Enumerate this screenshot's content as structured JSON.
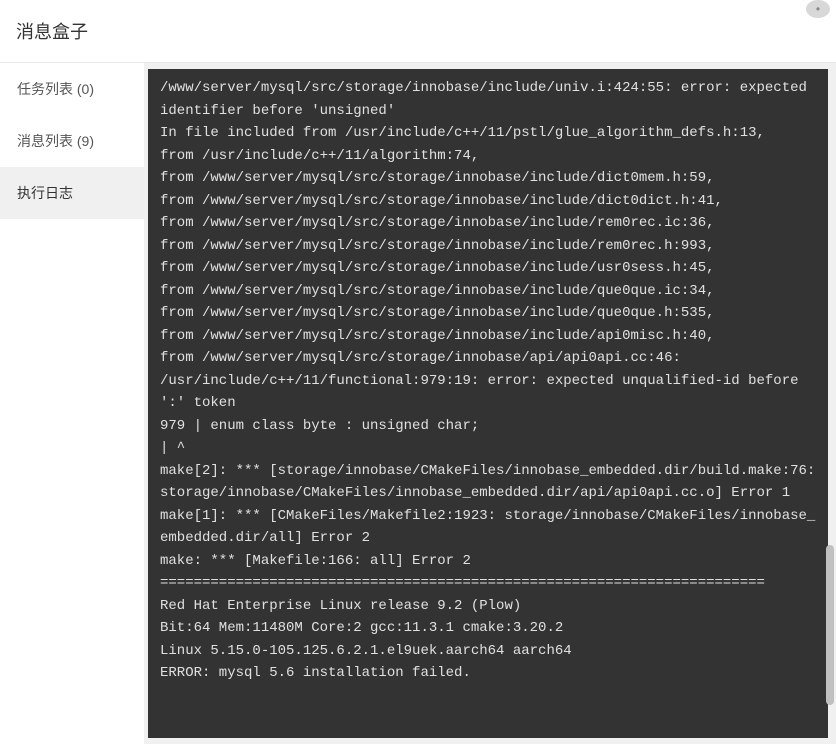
{
  "header": {
    "title": "消息盒子"
  },
  "sidebar": {
    "items": [
      {
        "label": "任务列表 (0)",
        "key": "task-list",
        "active": false
      },
      {
        "label": "消息列表 (9)",
        "key": "message-list",
        "active": false
      },
      {
        "label": "执行日志",
        "key": "exec-log",
        "active": true
      }
    ]
  },
  "log": {
    "lines": [
      "/www/server/mysql/src/storage/innobase/include/univ.i:424:55: error: expected identifier before 'unsigned'",
      "In file included from /usr/include/c++/11/pstl/glue_algorithm_defs.h:13,",
      "from /usr/include/c++/11/algorithm:74,",
      "from /www/server/mysql/src/storage/innobase/include/dict0mem.h:59,",
      "from /www/server/mysql/src/storage/innobase/include/dict0dict.h:41,",
      "from /www/server/mysql/src/storage/innobase/include/rem0rec.ic:36,",
      "from /www/server/mysql/src/storage/innobase/include/rem0rec.h:993,",
      "from /www/server/mysql/src/storage/innobase/include/usr0sess.h:45,",
      "from /www/server/mysql/src/storage/innobase/include/que0que.ic:34,",
      "from /www/server/mysql/src/storage/innobase/include/que0que.h:535,",
      "from /www/server/mysql/src/storage/innobase/include/api0misc.h:40,",
      "from /www/server/mysql/src/storage/innobase/api/api0api.cc:46:",
      "/usr/include/c++/11/functional:979:19: error: expected unqualified-id before ':' token",
      "979 | enum class byte : unsigned char;",
      "| ^",
      "make[2]: *** [storage/innobase/CMakeFiles/innobase_embedded.dir/build.make:76: storage/innobase/CMakeFiles/innobase_embedded.dir/api/api0api.cc.o] Error 1",
      "make[1]: *** [CMakeFiles/Makefile2:1923: storage/innobase/CMakeFiles/innobase_embedded.dir/all] Error 2",
      "make: *** [Makefile:166: all] Error 2",
      "========================================================================",
      "Red Hat Enterprise Linux release 9.2 (Plow)",
      "Bit:64 Mem:11480M Core:2 gcc:11.3.1 cmake:3.20.2",
      "Linux 5.15.0-105.125.6.2.1.el9uek.aarch64 aarch64",
      "ERROR: mysql 5.6 installation failed."
    ]
  }
}
